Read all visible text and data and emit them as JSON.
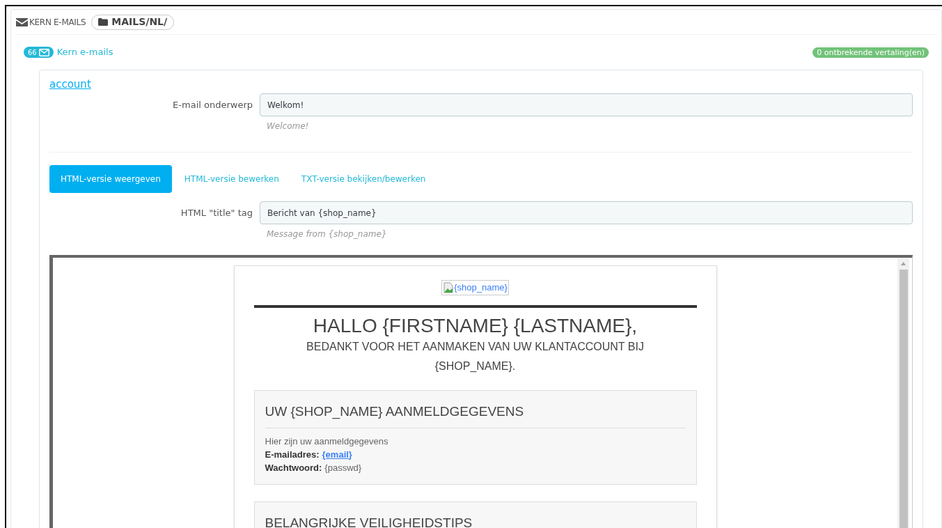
{
  "header": {
    "title": "KERN E-MAILS",
    "path": "MAILS/NL/"
  },
  "subheader": {
    "count": "66",
    "link": "Kern e-mails",
    "missing_badge": "0 ontbrekende vertaling(en)"
  },
  "template": {
    "name": "account",
    "subject": {
      "label": "E-mail onderwerp",
      "value": "Welkom!",
      "hint": "Welcome!"
    },
    "tabs": [
      {
        "label": "HTML-versie weergeven",
        "selected": true
      },
      {
        "label": "HTML-versie bewerken",
        "selected": false
      },
      {
        "label": "TXT-versie bekijken/bewerken",
        "selected": false
      }
    ],
    "title_tag": {
      "label": "HTML \"title\" tag",
      "value": "Bericht van {shop_name}",
      "hint": "Message from {shop_name}"
    }
  },
  "preview": {
    "logo_alt": "{shop_name}",
    "heading": "HALLO {FIRSTNAME} {LASTNAME},",
    "subheading": "BEDANKT VOOR HET AANMAKEN VAN UW KLANTACCOUNT BIJ {SHOP_NAME}.",
    "sections": [
      {
        "title": "UW {SHOP_NAME} AANMELDGEGEVENS",
        "intro": "Hier zijn uw aanmeldgegevens",
        "lines": [
          {
            "label": "E-mailadres:",
            "value": "{email}",
            "kind": "link"
          },
          {
            "label": "Wachtwoord:",
            "value": "{passwd}",
            "kind": "plain"
          }
        ]
      },
      {
        "title": "BELANGRIJKE VEILIGHEIDSTIPS"
      }
    ]
  }
}
